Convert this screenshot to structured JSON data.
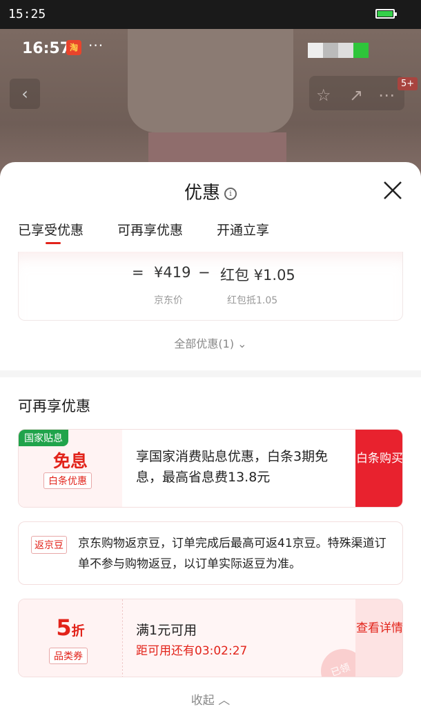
{
  "status_bar": {
    "time": "15:25",
    "battery_level": 1.0,
    "battery_color": "#35d04a"
  },
  "background_app": {
    "time": "16:57",
    "app_icon": "taobao-app-icon",
    "app_badge_text": "淘",
    "more_dots": "···",
    "cart_badge": "5+",
    "icons": [
      "back-icon",
      "star-icon",
      "share-icon",
      "more-icon"
    ]
  },
  "sheet": {
    "title": "优惠",
    "info_symbol": "i",
    "tabs": [
      {
        "label": "已享受优惠",
        "active": true
      },
      {
        "label": "可再享优惠",
        "active": false
      },
      {
        "label": "开通立享",
        "active": false
      }
    ],
    "price_breakdown": {
      "equals": "=",
      "price": "¥419",
      "minus": "−",
      "redpacket": "红包 ¥1.05",
      "price_caption": "京东价",
      "redpacket_caption": "红包抵1.05"
    },
    "all_offers_link": "全部优惠(1)",
    "section_title": "可再享优惠",
    "offers": [
      {
        "tag": "国家贴息",
        "headline": "免息",
        "chip": "白条优惠",
        "text": "享国家消费贴息优惠，白条3期免息，最高省息费13.8元",
        "action": "白条购买"
      },
      {
        "tag": "返京豆",
        "text": "京东购物返京豆，订单完成后最高可返41京豆。特殊渠道订单不参与购物返豆，以订单实际返豆为准。"
      },
      {
        "discount_number": "5",
        "discount_unit": "折",
        "chip": "品类券",
        "line1": "满1元可用",
        "line2": "距可用还有03:02:27",
        "action": "查看详情",
        "stamp_text": "已领"
      }
    ],
    "collapse_link": "收起"
  },
  "colors": {
    "accent": "#e2231a",
    "gov_green": "#20a34b",
    "action_red": "#e8222e"
  }
}
